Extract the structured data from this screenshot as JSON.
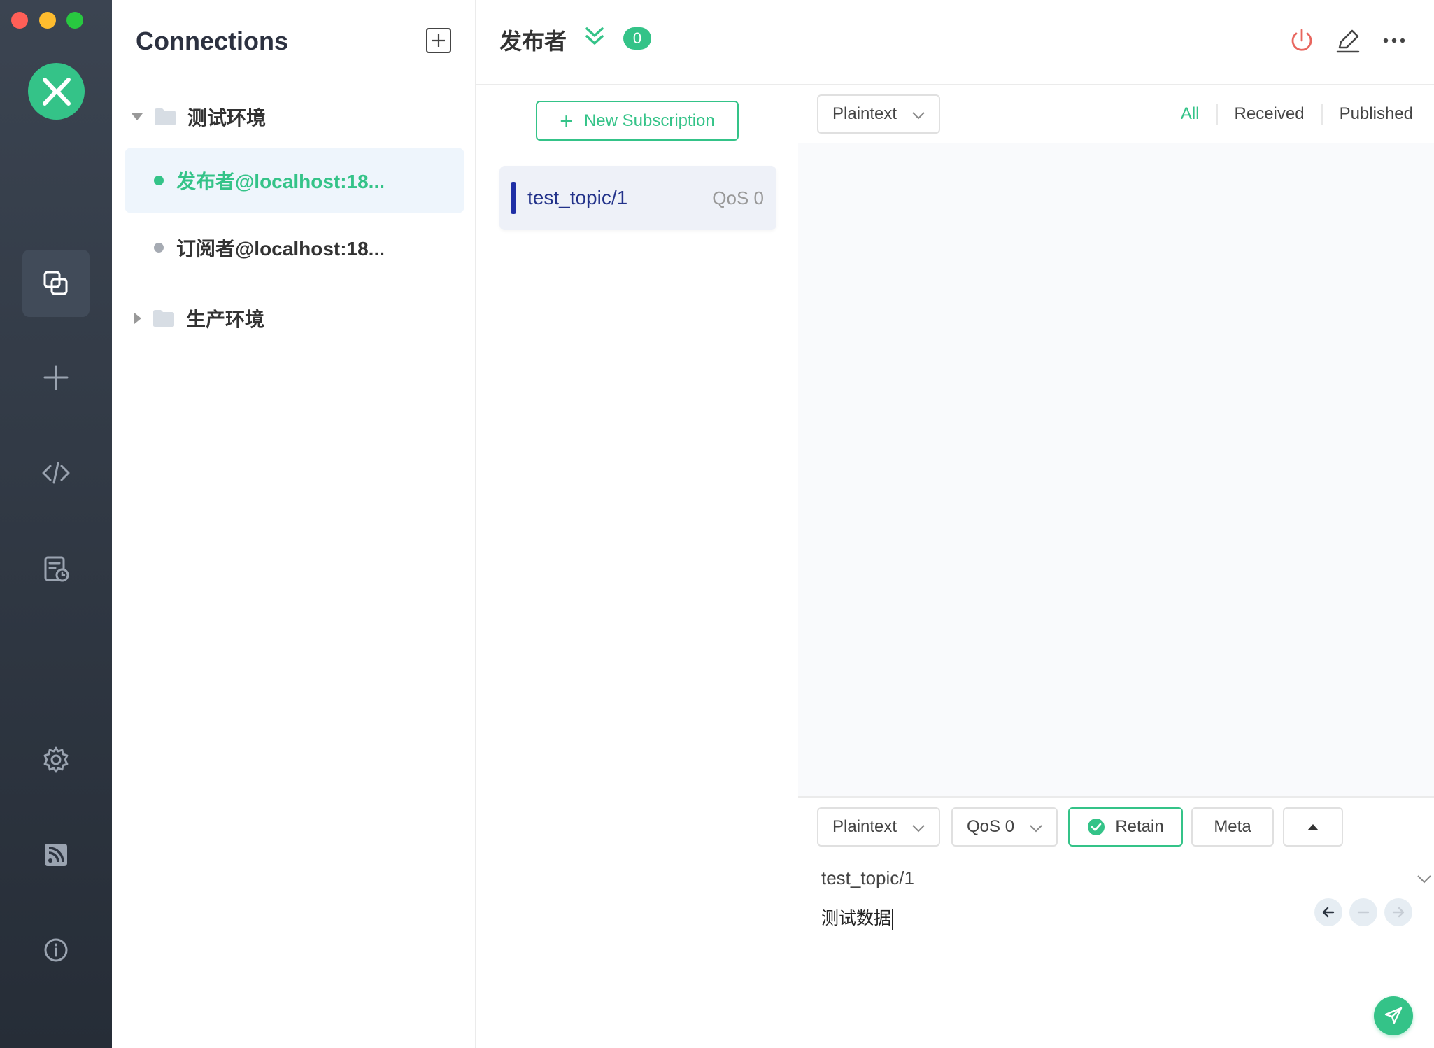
{
  "sidebar": {
    "nav": [
      {
        "icon": "connections-icon",
        "active": true
      },
      {
        "icon": "plus-icon",
        "active": false
      },
      {
        "icon": "script-icon",
        "active": false
      },
      {
        "icon": "log-icon",
        "active": false
      },
      {
        "icon": "settings-icon",
        "active": false
      },
      {
        "icon": "feed-icon",
        "active": false
      },
      {
        "icon": "info-icon",
        "active": false
      }
    ]
  },
  "connections": {
    "title": "Connections",
    "groups": [
      {
        "name": "测试环境",
        "expanded": true,
        "items": [
          {
            "label": "发布者@localhost:18...",
            "status": "online",
            "active": true
          },
          {
            "label": "订阅者@localhost:18...",
            "status": "offline",
            "active": false
          }
        ]
      },
      {
        "name": "生产环境",
        "expanded": false,
        "items": []
      }
    ]
  },
  "header": {
    "title": "发布者",
    "badge": "0"
  },
  "subscriptions": {
    "new_label": "New Subscription",
    "items": [
      {
        "topic": "test_topic/1",
        "qos": "QoS 0",
        "color": "#1f2fa6"
      }
    ]
  },
  "messages": {
    "format": "Plaintext",
    "filters": [
      "All",
      "Received",
      "Published"
    ],
    "active_filter": "All"
  },
  "publish": {
    "format": "Plaintext",
    "qos": "QoS 0",
    "retain_label": "Retain",
    "meta_label": "Meta",
    "topic": "test_topic/1",
    "payload": "测试数据"
  },
  "colors": {
    "accent": "#34c388",
    "danger": "#e8665e",
    "topic_bar": "#1f2fa6"
  }
}
